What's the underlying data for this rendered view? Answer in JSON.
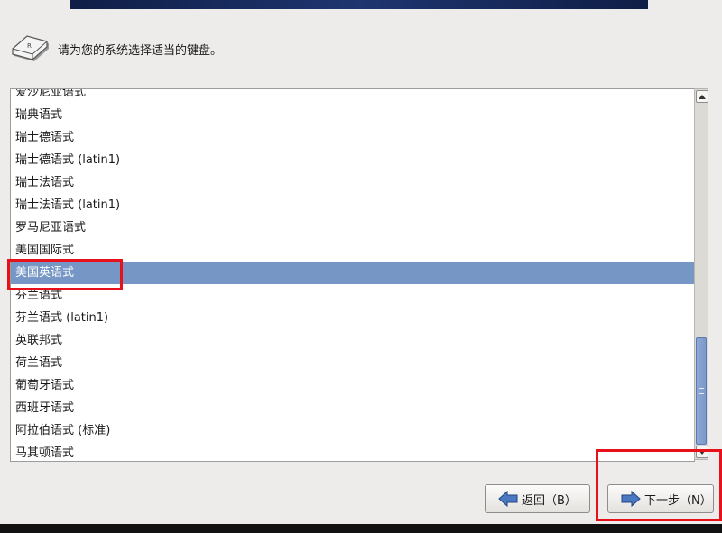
{
  "header": {
    "prompt": "请为您的系统选择适当的键盘。",
    "icon": "keyboard-key-icon"
  },
  "keyboard_list": {
    "items": [
      {
        "label": "爱沙尼亚语式"
      },
      {
        "label": "瑞典语式"
      },
      {
        "label": "瑞士德语式"
      },
      {
        "label": "瑞士德语式 (latin1)"
      },
      {
        "label": "瑞士法语式"
      },
      {
        "label": "瑞士法语式 (latin1)"
      },
      {
        "label": "罗马尼亚语式"
      },
      {
        "label": "美国国际式"
      },
      {
        "label": "美国英语式",
        "selected": true
      },
      {
        "label": "芬兰语式"
      },
      {
        "label": "芬兰语式 (latin1)"
      },
      {
        "label": "英联邦式"
      },
      {
        "label": "荷兰语式"
      },
      {
        "label": "葡萄牙语式"
      },
      {
        "label": "西班牙语式"
      },
      {
        "label": "阿拉伯语式 (标准)"
      },
      {
        "label": "马其顿语式"
      }
    ],
    "selected_index": 8
  },
  "buttons": {
    "back_label": "返回（B）",
    "next_label": "下一步（N）"
  },
  "colors": {
    "selection": "#7696c6",
    "highlight_box": "#e8101a",
    "banner": "#1a2c5e"
  }
}
